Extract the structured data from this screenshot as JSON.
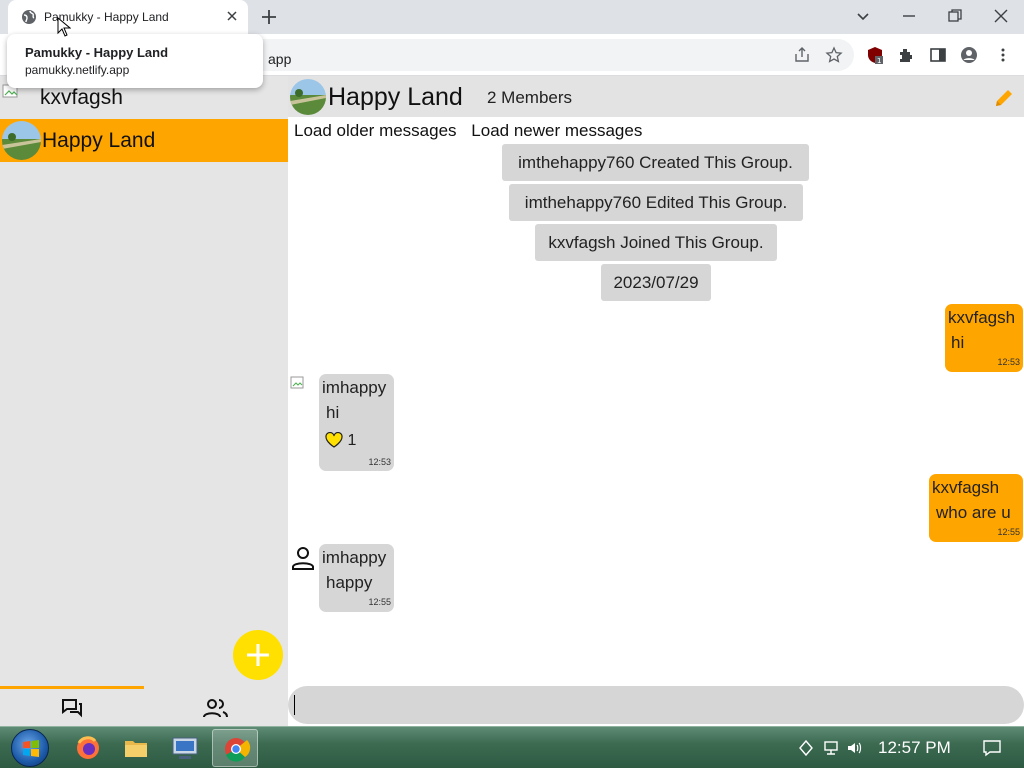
{
  "browser": {
    "tab_title": "Pamukky - Happy Land",
    "omnibox_text": "app",
    "tooltip": {
      "title": "Pamukky - Happy Land",
      "url": "pamukky.netlify.app"
    }
  },
  "sidebar": {
    "current_user": "kxvfagsh",
    "groups": [
      {
        "label": "Happy Land",
        "selected": true
      }
    ],
    "accent_color": "#ffa500"
  },
  "chat": {
    "title": "Happy Land",
    "members": "2 Members",
    "load_older": "Load older messages",
    "load_newer": "Load newer messages",
    "system_messages": [
      "imthehappy760 Created This Group.",
      "imthehappy760 Edited This Group.",
      "kxvfagsh Joined This Group.",
      "2023/07/29"
    ],
    "messages": [
      {
        "sender": "kxvfagsh",
        "text": "hi",
        "time": "12:53",
        "mine": true
      },
      {
        "sender": "imhappy",
        "text": "hi",
        "time": "12:53",
        "mine": false,
        "reaction": {
          "icon": "heart-icon",
          "count": "1"
        }
      },
      {
        "sender": "kxvfagsh",
        "text": "who are u",
        "time": "12:55",
        "mine": true
      },
      {
        "sender": "imhappy",
        "text": "happy",
        "time": "12:55",
        "mine": false
      }
    ]
  },
  "taskbar": {
    "clock": "12:57 PM",
    "apps": [
      "firefox-icon",
      "file-explorer-icon",
      "network-app-icon",
      "chrome-icon"
    ]
  }
}
